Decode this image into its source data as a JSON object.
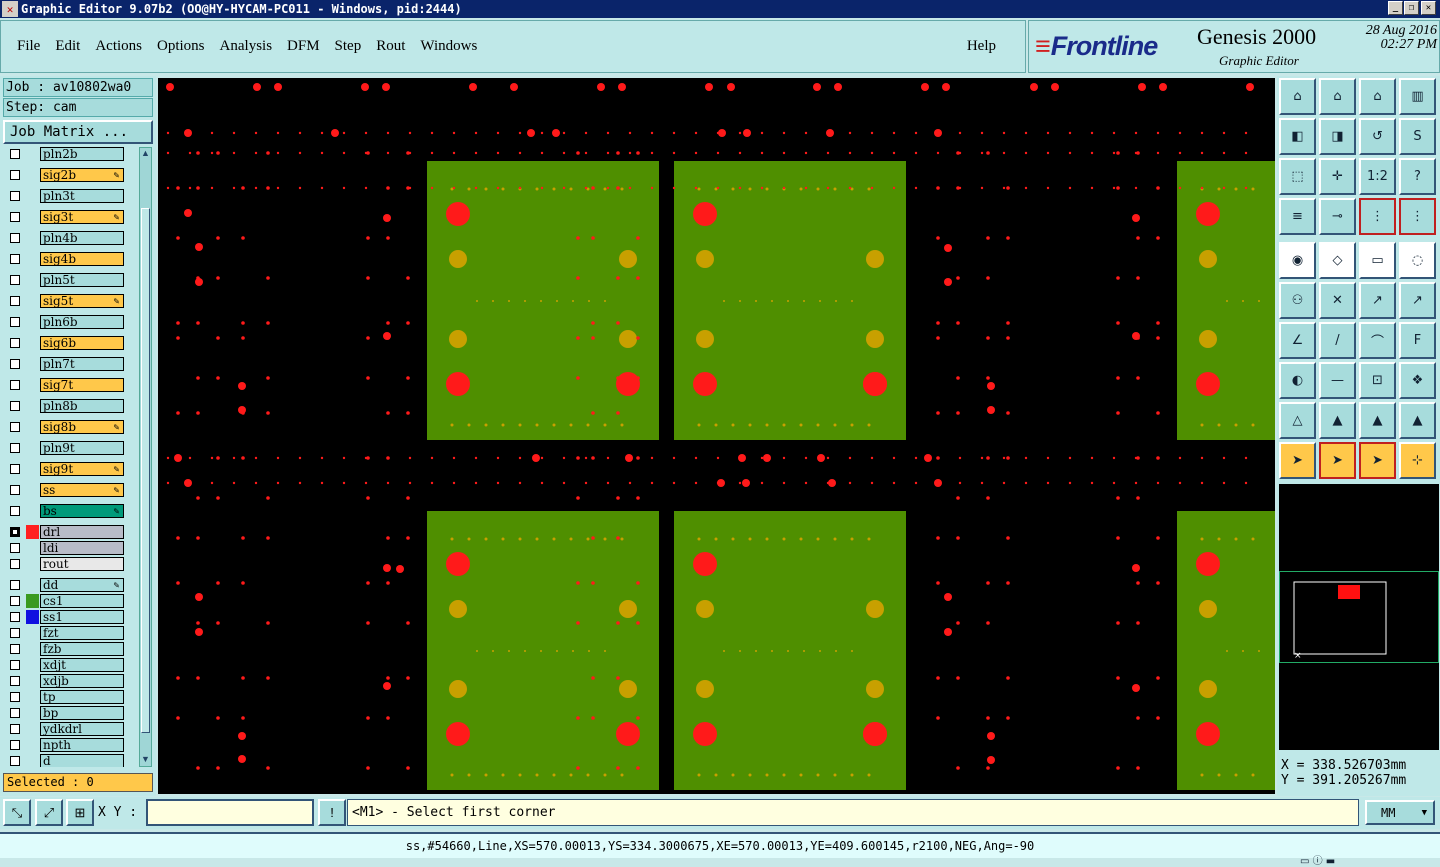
{
  "window": {
    "title": "Graphic Editor 9.07b2 (OO@HY-HYCAM-PC011 - Windows, pid:2444)",
    "min": "_",
    "max": "❐",
    "close": "✕"
  },
  "menu": [
    "File",
    "Edit",
    "Actions",
    "Options",
    "Analysis",
    "DFM",
    "Step",
    "Rout",
    "Windows"
  ],
  "help": "Help",
  "brand": {
    "logo": "Frontline",
    "product": "Genesis 2000",
    "subtitle": "Graphic Editor",
    "date": "28 Aug 2016",
    "time": "02:27 PM"
  },
  "job": "Job : av10802wa0",
  "step": "Step: cam",
  "job_matrix": "Job Matrix ...",
  "layers": [
    {
      "name": "pln2b",
      "style": "c",
      "swatch": "",
      "edit": false,
      "active": false
    },
    {
      "name": "sig2b",
      "style": "o",
      "swatch": "",
      "edit": true,
      "active": false
    },
    {
      "name": "pln3t",
      "style": "c",
      "swatch": "",
      "edit": false,
      "active": false
    },
    {
      "name": "sig3t",
      "style": "o",
      "swatch": "",
      "edit": true,
      "active": false
    },
    {
      "name": "pln4b",
      "style": "c",
      "swatch": "",
      "edit": false,
      "active": false
    },
    {
      "name": "sig4b",
      "style": "o",
      "swatch": "",
      "edit": false,
      "active": false
    },
    {
      "name": "pln5t",
      "style": "c",
      "swatch": "",
      "edit": false,
      "active": false
    },
    {
      "name": "sig5t",
      "style": "o",
      "swatch": "",
      "edit": true,
      "active": false
    },
    {
      "name": "pln6b",
      "style": "c",
      "swatch": "",
      "edit": false,
      "active": false
    },
    {
      "name": "sig6b",
      "style": "o",
      "swatch": "",
      "edit": false,
      "active": false
    },
    {
      "name": "pln7t",
      "style": "c",
      "swatch": "",
      "edit": false,
      "active": false
    },
    {
      "name": "sig7t",
      "style": "o",
      "swatch": "",
      "edit": false,
      "active": false
    },
    {
      "name": "pln8b",
      "style": "c",
      "swatch": "",
      "edit": false,
      "active": false
    },
    {
      "name": "sig8b",
      "style": "o",
      "swatch": "",
      "edit": true,
      "active": false
    },
    {
      "name": "pln9t",
      "style": "c",
      "swatch": "",
      "edit": false,
      "active": false
    },
    {
      "name": "sig9t",
      "style": "o",
      "swatch": "",
      "edit": true,
      "active": false
    },
    {
      "name": "ss",
      "style": "o",
      "swatch": "",
      "edit": true,
      "active": false
    },
    {
      "name": "bs",
      "style": "g",
      "swatch": "",
      "edit": true,
      "active": false
    },
    {
      "name": "drl",
      "style": "gr",
      "swatch": "#ff2020",
      "edit": false,
      "active": true
    },
    {
      "name": "ldi",
      "style": "gr",
      "swatch": "",
      "edit": false,
      "active": false
    },
    {
      "name": "rout",
      "style": "w",
      "swatch": "",
      "edit": false,
      "active": false
    },
    {
      "name": "dd",
      "style": "c",
      "swatch": "",
      "edit": true,
      "active": false
    },
    {
      "name": "cs1",
      "style": "c",
      "swatch": "#3a9a20",
      "edit": false,
      "active": false
    },
    {
      "name": "ss1",
      "style": "c",
      "swatch": "#1010e0",
      "edit": false,
      "active": false
    },
    {
      "name": "fzt",
      "style": "c",
      "swatch": "",
      "edit": false,
      "active": false
    },
    {
      "name": "fzb",
      "style": "c",
      "swatch": "",
      "edit": false,
      "active": false
    },
    {
      "name": "xdjt",
      "style": "c",
      "swatch": "",
      "edit": false,
      "active": false
    },
    {
      "name": "xdjb",
      "style": "c",
      "swatch": "",
      "edit": false,
      "active": false
    },
    {
      "name": "tp",
      "style": "c",
      "swatch": "",
      "edit": false,
      "active": false
    },
    {
      "name": "bp",
      "style": "c",
      "swatch": "",
      "edit": false,
      "active": false
    },
    {
      "name": "ydkdrl",
      "style": "c",
      "swatch": "",
      "edit": false,
      "active": false
    },
    {
      "name": "npth",
      "style": "c",
      "swatch": "",
      "edit": false,
      "active": false
    },
    {
      "name": "d",
      "style": "c",
      "swatch": "",
      "edit": false,
      "active": false
    }
  ],
  "selected": "Selected : 0",
  "coords": {
    "x": "X = 338.526703mm",
    "y": "Y = 391.205267mm"
  },
  "xy_label": "X Y :",
  "xy_value": "",
  "prompt": "<M1> - Select first corner",
  "units": "MM",
  "status": "ss,#54660,Line,XS=570.00013,YS=334.3000675,XE=570.00013,YE=409.600145,r2100,NEG,Ang=-90",
  "tools": [
    {
      "name": "home-view-icon",
      "g": "⌂"
    },
    {
      "name": "zoom-home-icon",
      "g": "⌂"
    },
    {
      "name": "house-icon",
      "g": "⌂"
    },
    {
      "name": "window-split-icon",
      "g": "▥"
    },
    {
      "name": "pan-left-icon",
      "g": "◧"
    },
    {
      "name": "pan-right-icon",
      "g": "◨"
    },
    {
      "name": "zoom-back-icon",
      "g": "↺"
    },
    {
      "name": "redraw-icon",
      "g": "S"
    },
    {
      "name": "fit-all-icon",
      "g": "⬚"
    },
    {
      "name": "zoom-center-icon",
      "g": "✛"
    },
    {
      "name": "scale-1-2-icon",
      "g": "1:2"
    },
    {
      "name": "query-icon",
      "g": "?"
    },
    {
      "name": "measure-icon",
      "g": "≡"
    },
    {
      "name": "snap-icon",
      "g": "⊸"
    },
    {
      "name": "layer-compare-icon",
      "g": "⋮"
    },
    {
      "name": "layer-compare-2-icon",
      "g": "⋮"
    },
    {
      "name": "pad-add-icon",
      "g": "◉"
    },
    {
      "name": "line-add-icon",
      "g": "◇"
    },
    {
      "name": "ruler-icon",
      "g": "▭"
    },
    {
      "name": "dashed-circle-icon",
      "g": "◌"
    },
    {
      "name": "connect-icon",
      "g": "⚇"
    },
    {
      "name": "delete-icon",
      "g": "✕"
    },
    {
      "name": "move-icon",
      "g": "↗"
    },
    {
      "name": "copy-icon",
      "g": "↗"
    },
    {
      "name": "angle-icon",
      "g": "∠"
    },
    {
      "name": "line-draw-icon",
      "g": "/"
    },
    {
      "name": "arc-icon",
      "g": "⌒"
    },
    {
      "name": "text-icon",
      "g": "F"
    },
    {
      "name": "resize-icon",
      "g": "◐"
    },
    {
      "name": "cut-icon",
      "g": "—"
    },
    {
      "name": "fit-box-icon",
      "g": "⊡"
    },
    {
      "name": "group-icon",
      "g": "❖"
    },
    {
      "name": "polygon-icon",
      "g": "△"
    },
    {
      "name": "shape-icon",
      "g": "▲"
    },
    {
      "name": "surface-icon",
      "g": "▲"
    },
    {
      "name": "contour-icon",
      "g": "▲"
    },
    {
      "name": "pointer-icon",
      "g": "➤"
    },
    {
      "name": "select-icon",
      "g": "➤"
    },
    {
      "name": "select-box-icon",
      "g": "➤"
    },
    {
      "name": "net-select-icon",
      "g": "⊹"
    }
  ]
}
